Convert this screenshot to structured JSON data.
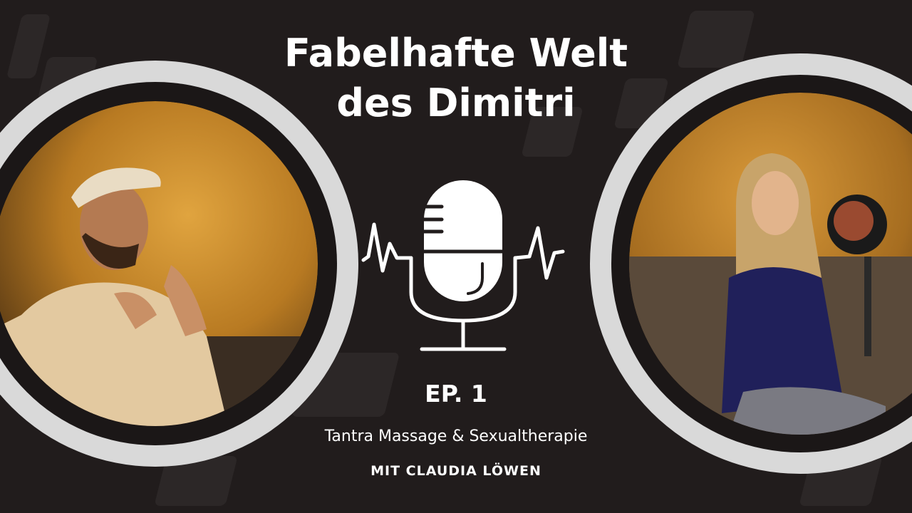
{
  "title_line1": "Fabelhafte Welt",
  "title_line2": "des Dimitri",
  "episode": "EP. 1",
  "topic": "Tantra Massage & Sexualtherapie",
  "guest": "MIT CLAUDIA LÖWEN",
  "icons": {
    "center": "podcast-microphone-icon"
  },
  "colors": {
    "background": "#211c1c",
    "ring": "#d9d9d9",
    "text": "#ffffff",
    "photo_warm": "#c98a2e"
  }
}
